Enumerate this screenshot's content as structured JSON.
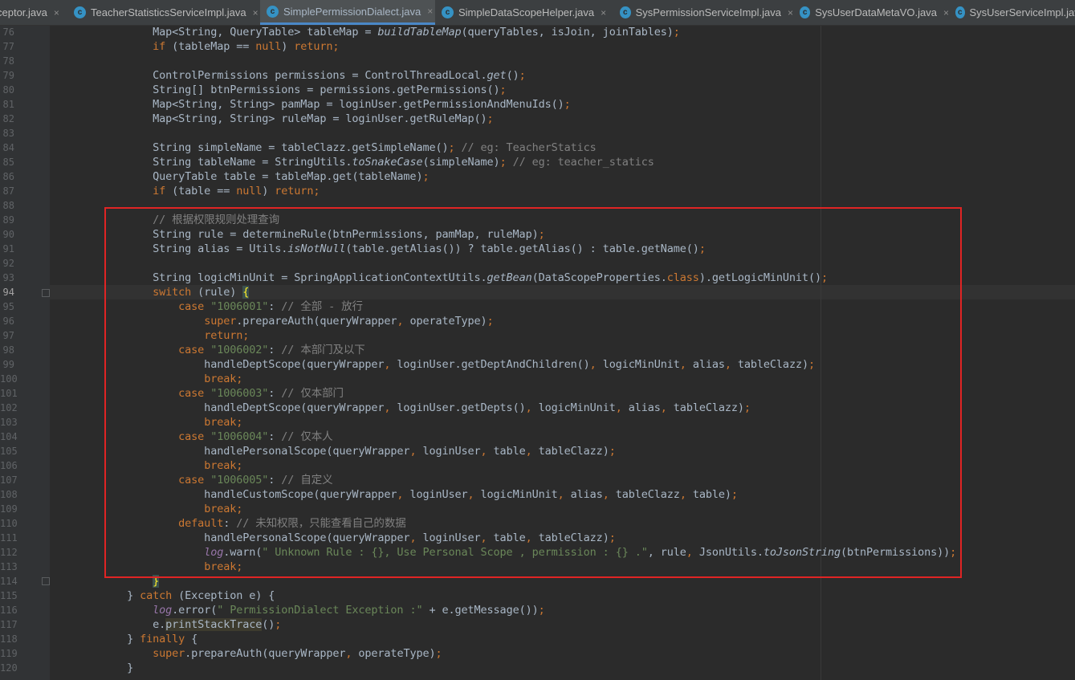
{
  "tabs": [
    {
      "label": "ceptor.java",
      "icon": "java-class-icon",
      "active": false
    },
    {
      "label": "TeacherStatisticsServiceImpl.java",
      "icon": "java-class-icon",
      "active": false
    },
    {
      "label": "SimplePermissionDialect.java",
      "icon": "java-class-icon",
      "active": true
    },
    {
      "label": "SimpleDataScopeHelper.java",
      "icon": "java-class-icon",
      "active": false
    },
    {
      "label": "SysPermissionServiceImpl.java",
      "icon": "java-class-icon",
      "active": false
    },
    {
      "label": "SysUserDataMetaVO.java",
      "icon": "java-class-icon",
      "active": false
    },
    {
      "label": "SysUserServiceImpl.java",
      "icon": "java-class-icon",
      "active": false
    }
  ],
  "tab_close_glyph": "×",
  "current_line": "94",
  "colors": {
    "background": "#2b2b2b",
    "keyword": "#cc7832",
    "string": "#6a8759",
    "comment": "#808080",
    "highlight_box": "#e02424"
  },
  "code": [
    {
      "n": "76",
      "parts": [
        {
          "t": "                Map<String, QueryTable> tableMap = "
        },
        {
          "t": "buildTableMap",
          "c": "f"
        },
        {
          "t": "(queryTables, isJoin, joinTables)"
        },
        {
          "t": ";",
          "c": "k"
        }
      ]
    },
    {
      "n": "77",
      "parts": [
        {
          "t": "                "
        },
        {
          "t": "if",
          "c": "k"
        },
        {
          "t": " (tableMap == "
        },
        {
          "t": "null",
          "c": "k"
        },
        {
          "t": ") "
        },
        {
          "t": "return;",
          "c": "k"
        }
      ]
    },
    {
      "n": "78",
      "parts": []
    },
    {
      "n": "79",
      "parts": [
        {
          "t": "                ControlPermissions permissions = ControlThreadLocal."
        },
        {
          "t": "get",
          "c": "f"
        },
        {
          "t": "()"
        },
        {
          "t": ";",
          "c": "k"
        }
      ]
    },
    {
      "n": "80",
      "parts": [
        {
          "t": "                String[] btnPermissions = permissions.getPermissions()"
        },
        {
          "t": ";",
          "c": "k"
        }
      ]
    },
    {
      "n": "81",
      "parts": [
        {
          "t": "                Map<String, String> pamMap = loginUser.getPermissionAndMenuIds()"
        },
        {
          "t": ";",
          "c": "k"
        }
      ]
    },
    {
      "n": "82",
      "parts": [
        {
          "t": "                Map<String, String> ruleMap = loginUser.getRuleMap()"
        },
        {
          "t": ";",
          "c": "k"
        }
      ]
    },
    {
      "n": "83",
      "parts": []
    },
    {
      "n": "84",
      "parts": [
        {
          "t": "                String simpleName = tableClazz.getSimpleName()"
        },
        {
          "t": ";",
          "c": "k"
        },
        {
          "t": " // eg: TeacherStatics",
          "c": "c"
        }
      ]
    },
    {
      "n": "85",
      "parts": [
        {
          "t": "                String tableName = StringUtils."
        },
        {
          "t": "toSnakeCase",
          "c": "f"
        },
        {
          "t": "(simpleName)"
        },
        {
          "t": ";",
          "c": "k"
        },
        {
          "t": " // eg: teacher_statics",
          "c": "c"
        }
      ]
    },
    {
      "n": "86",
      "parts": [
        {
          "t": "                QueryTable table = tableMap.get(tableName)"
        },
        {
          "t": ";",
          "c": "k"
        }
      ]
    },
    {
      "n": "87",
      "parts": [
        {
          "t": "                "
        },
        {
          "t": "if",
          "c": "k"
        },
        {
          "t": " (table == "
        },
        {
          "t": "null",
          "c": "k"
        },
        {
          "t": ") "
        },
        {
          "t": "return;",
          "c": "k"
        }
      ]
    },
    {
      "n": "88",
      "parts": []
    },
    {
      "n": "89",
      "parts": [
        {
          "t": "                // 根据权限规则处理查询",
          "c": "c"
        }
      ]
    },
    {
      "n": "90",
      "parts": [
        {
          "t": "                String rule = determineRule(btnPermissions, pamMap, ruleMap)"
        },
        {
          "t": ";",
          "c": "k"
        }
      ]
    },
    {
      "n": "91",
      "parts": [
        {
          "t": "                String alias = Utils."
        },
        {
          "t": "isNotNull",
          "c": "f"
        },
        {
          "t": "(table.getAlias()) ? table.getAlias() : table.getName()"
        },
        {
          "t": ";",
          "c": "k"
        }
      ]
    },
    {
      "n": "92",
      "parts": []
    },
    {
      "n": "93",
      "parts": [
        {
          "t": "                String logicMinUnit = SpringApplicationContextUtils."
        },
        {
          "t": "getBean",
          "c": "f"
        },
        {
          "t": "(DataScopeProperties."
        },
        {
          "t": "class",
          "c": "k"
        },
        {
          "t": ").getLogicMinUnit()"
        },
        {
          "t": ";",
          "c": "k"
        }
      ]
    },
    {
      "n": "94",
      "parts": [
        {
          "t": "                "
        },
        {
          "t": "switch",
          "c": "k"
        },
        {
          "t": " (rule) "
        },
        {
          "t": "{",
          "c": "match"
        }
      ]
    },
    {
      "n": "95",
      "parts": [
        {
          "t": "                    "
        },
        {
          "t": "case",
          "c": "k"
        },
        {
          "t": " "
        },
        {
          "t": "\"1006001\"",
          "c": "s"
        },
        {
          "t": ": "
        },
        {
          "t": "// 全部 - 放行",
          "c": "c"
        }
      ]
    },
    {
      "n": "96",
      "parts": [
        {
          "t": "                        "
        },
        {
          "t": "super",
          "c": "k"
        },
        {
          "t": ".prepareAuth(queryWrapper"
        },
        {
          "t": ",",
          "c": "k"
        },
        {
          "t": " operateType)"
        },
        {
          "t": ";",
          "c": "k"
        }
      ]
    },
    {
      "n": "97",
      "parts": [
        {
          "t": "                        "
        },
        {
          "t": "return;",
          "c": "k"
        }
      ]
    },
    {
      "n": "98",
      "parts": [
        {
          "t": "                    "
        },
        {
          "t": "case",
          "c": "k"
        },
        {
          "t": " "
        },
        {
          "t": "\"1006002\"",
          "c": "s"
        },
        {
          "t": ": "
        },
        {
          "t": "// 本部门及以下",
          "c": "c"
        }
      ]
    },
    {
      "n": "99",
      "parts": [
        {
          "t": "                        handleDeptScope(queryWrapper"
        },
        {
          "t": ",",
          "c": "k"
        },
        {
          "t": " loginUser.getDeptAndChildren()"
        },
        {
          "t": ",",
          "c": "k"
        },
        {
          "t": " logicMinUnit"
        },
        {
          "t": ",",
          "c": "k"
        },
        {
          "t": " alias"
        },
        {
          "t": ",",
          "c": "k"
        },
        {
          "t": " tableClazz)"
        },
        {
          "t": ";",
          "c": "k"
        }
      ]
    },
    {
      "n": "100",
      "parts": [
        {
          "t": "                        "
        },
        {
          "t": "break;",
          "c": "k"
        }
      ]
    },
    {
      "n": "101",
      "parts": [
        {
          "t": "                    "
        },
        {
          "t": "case",
          "c": "k"
        },
        {
          "t": " "
        },
        {
          "t": "\"1006003\"",
          "c": "s"
        },
        {
          "t": ": "
        },
        {
          "t": "// 仅本部门",
          "c": "c"
        }
      ]
    },
    {
      "n": "102",
      "parts": [
        {
          "t": "                        handleDeptScope(queryWrapper"
        },
        {
          "t": ",",
          "c": "k"
        },
        {
          "t": " loginUser.getDepts()"
        },
        {
          "t": ",",
          "c": "k"
        },
        {
          "t": " logicMinUnit"
        },
        {
          "t": ",",
          "c": "k"
        },
        {
          "t": " alias"
        },
        {
          "t": ",",
          "c": "k"
        },
        {
          "t": " tableClazz)"
        },
        {
          "t": ";",
          "c": "k"
        }
      ]
    },
    {
      "n": "103",
      "parts": [
        {
          "t": "                        "
        },
        {
          "t": "break;",
          "c": "k"
        }
      ]
    },
    {
      "n": "104",
      "parts": [
        {
          "t": "                    "
        },
        {
          "t": "case",
          "c": "k"
        },
        {
          "t": " "
        },
        {
          "t": "\"1006004\"",
          "c": "s"
        },
        {
          "t": ": "
        },
        {
          "t": "// 仅本人",
          "c": "c"
        }
      ]
    },
    {
      "n": "105",
      "parts": [
        {
          "t": "                        handlePersonalScope(queryWrapper"
        },
        {
          "t": ",",
          "c": "k"
        },
        {
          "t": " loginUser"
        },
        {
          "t": ",",
          "c": "k"
        },
        {
          "t": " table"
        },
        {
          "t": ",",
          "c": "k"
        },
        {
          "t": " tableClazz)"
        },
        {
          "t": ";",
          "c": "k"
        }
      ]
    },
    {
      "n": "106",
      "parts": [
        {
          "t": "                        "
        },
        {
          "t": "break;",
          "c": "k"
        }
      ]
    },
    {
      "n": "107",
      "parts": [
        {
          "t": "                    "
        },
        {
          "t": "case",
          "c": "k"
        },
        {
          "t": " "
        },
        {
          "t": "\"1006005\"",
          "c": "s"
        },
        {
          "t": ": "
        },
        {
          "t": "// 自定义",
          "c": "c"
        }
      ]
    },
    {
      "n": "108",
      "parts": [
        {
          "t": "                        handleCustomScope(queryWrapper"
        },
        {
          "t": ",",
          "c": "k"
        },
        {
          "t": " loginUser"
        },
        {
          "t": ",",
          "c": "k"
        },
        {
          "t": " logicMinUnit"
        },
        {
          "t": ",",
          "c": "k"
        },
        {
          "t": " alias"
        },
        {
          "t": ",",
          "c": "k"
        },
        {
          "t": " tableClazz"
        },
        {
          "t": ",",
          "c": "k"
        },
        {
          "t": " table)"
        },
        {
          "t": ";",
          "c": "k"
        }
      ]
    },
    {
      "n": "109",
      "parts": [
        {
          "t": "                        "
        },
        {
          "t": "break;",
          "c": "k"
        }
      ]
    },
    {
      "n": "110",
      "parts": [
        {
          "t": "                    "
        },
        {
          "t": "default",
          "c": "k"
        },
        {
          "t": ": "
        },
        {
          "t": "// 未知权限，只能查看自己的数据",
          "c": "c"
        }
      ]
    },
    {
      "n": "111",
      "parts": [
        {
          "t": "                        handlePersonalScope(queryWrapper"
        },
        {
          "t": ",",
          "c": "k"
        },
        {
          "t": " loginUser"
        },
        {
          "t": ",",
          "c": "k"
        },
        {
          "t": " table"
        },
        {
          "t": ",",
          "c": "k"
        },
        {
          "t": " tableClazz)"
        },
        {
          "t": ";",
          "c": "k"
        }
      ]
    },
    {
      "n": "112",
      "parts": [
        {
          "t": "                        "
        },
        {
          "t": "log",
          "c": "st"
        },
        {
          "t": ".warn("
        },
        {
          "t": "\" Unknown Rule : {}, Use Personal Scope , permission : {} .\"",
          "c": "s"
        },
        {
          "t": ","
        },
        {
          "t": " rule"
        },
        {
          "t": ",",
          "c": "k"
        },
        {
          "t": " JsonUtils."
        },
        {
          "t": "toJsonString",
          "c": "f"
        },
        {
          "t": "(btnPermissions))"
        },
        {
          "t": ";",
          "c": "k"
        }
      ]
    },
    {
      "n": "113",
      "parts": [
        {
          "t": "                        "
        },
        {
          "t": "break;",
          "c": "k"
        }
      ]
    },
    {
      "n": "114",
      "parts": [
        {
          "t": "                "
        },
        {
          "t": "}",
          "c": "match"
        }
      ]
    },
    {
      "n": "115",
      "parts": [
        {
          "t": "            } "
        },
        {
          "t": "catch",
          "c": "k"
        },
        {
          "t": " (Exception e) {"
        }
      ]
    },
    {
      "n": "116",
      "parts": [
        {
          "t": "                "
        },
        {
          "t": "log",
          "c": "st"
        },
        {
          "t": ".error("
        },
        {
          "t": "\" PermissionDialect Exception :\"",
          "c": "s"
        },
        {
          "t": " + e.getMessage())"
        },
        {
          "t": ";",
          "c": "k"
        }
      ]
    },
    {
      "n": "117",
      "parts": [
        {
          "t": "                e."
        },
        {
          "t": "printStackTrace",
          "c": "dep"
        },
        {
          "t": "()"
        },
        {
          "t": ";",
          "c": "k"
        }
      ]
    },
    {
      "n": "118",
      "parts": [
        {
          "t": "            } "
        },
        {
          "t": "finally",
          "c": "k"
        },
        {
          "t": " {"
        }
      ]
    },
    {
      "n": "119",
      "parts": [
        {
          "t": "                "
        },
        {
          "t": "super",
          "c": "k"
        },
        {
          "t": ".prepareAuth(queryWrapper"
        },
        {
          "t": ",",
          "c": "k"
        },
        {
          "t": " operateType)"
        },
        {
          "t": ";",
          "c": "k"
        }
      ]
    },
    {
      "n": "120",
      "parts": [
        {
          "t": "            }"
        }
      ]
    }
  ]
}
